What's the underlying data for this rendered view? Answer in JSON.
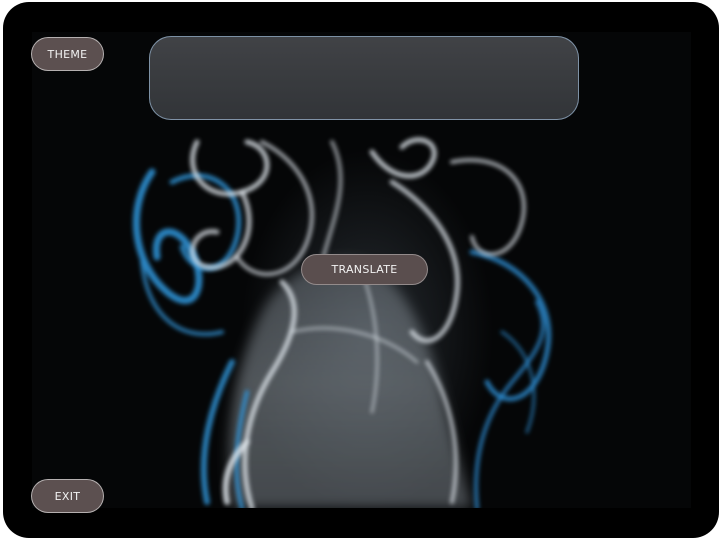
{
  "buttons": {
    "theme_label": "THEME",
    "translate_label": "TRANSLATE",
    "exit_label": "EXIT"
  },
  "colors": {
    "device_frame": "#000000",
    "button_fill": "#5c5050",
    "panel_border": "#96afc8",
    "smoke_blue": "#2f8fd0",
    "smoke_white": "#dfe6ec"
  },
  "background": {
    "image": "blue-and-white-smoke-icon"
  }
}
